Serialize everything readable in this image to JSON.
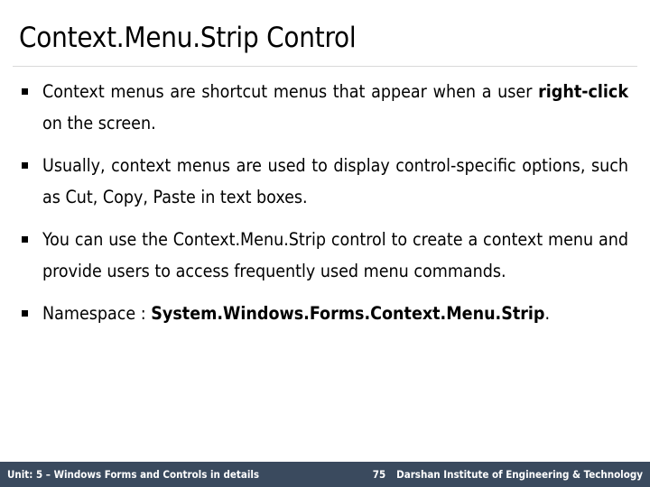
{
  "slide": {
    "title": "Context.Menu.Strip Control",
    "bullet_glyph": "square-bullet",
    "bullets": [
      {
        "id": "bullet-context-menus-definition",
        "parts": [
          {
            "text": "Context menus are shortcut menus that appear when a user ",
            "bold": false
          },
          {
            "text": "right-click",
            "bold": true
          },
          {
            "text": " on the screen.",
            "bold": false
          }
        ]
      },
      {
        "id": "bullet-control-specific-options",
        "parts": [
          {
            "text": "Usually, context menus are used to display control-specific options, such as Cut, Copy, Paste in text boxes.",
            "bold": false
          }
        ]
      },
      {
        "id": "bullet-contextmenustrip-usage",
        "parts": [
          {
            "text": "You can use the Context.Menu.Strip control to create a context menu and provide users to access frequently used menu commands.",
            "bold": false
          }
        ]
      },
      {
        "id": "bullet-namespace",
        "parts": [
          {
            "text": "Namespace : ",
            "bold": false
          },
          {
            "text": "System.Windows.Forms.Context.Menu.Strip",
            "bold": true
          },
          {
            "text": ".",
            "bold": false
          }
        ]
      }
    ]
  },
  "footer": {
    "unit_label": "Unit: 5 – Windows Forms and Controls in details",
    "page_number": "75",
    "institute": "Darshan Institute of Engineering & Technology",
    "bar_color": "#3a4a5e",
    "text_color": "#ffffff"
  },
  "theme": {
    "background": "#ffffff",
    "title_color": "#000000",
    "body_color": "#000000",
    "rule_color": "#d9d9d9"
  }
}
